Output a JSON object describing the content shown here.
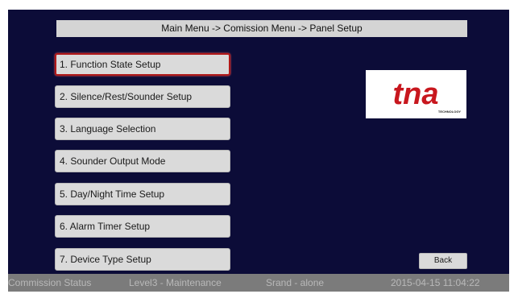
{
  "breadcrumb": "Main Menu -> Comission Menu -> Panel Setup",
  "menu": {
    "items": [
      {
        "label": "1. Function State Setup",
        "selected": true
      },
      {
        "label": "2. Silence/Rest/Sounder Setup",
        "selected": false
      },
      {
        "label": "3. Language Selection",
        "selected": false
      },
      {
        "label": "4. Sounder Output Mode",
        "selected": false
      },
      {
        "label": "5. Day/Night Time Setup",
        "selected": false
      },
      {
        "label": "6. Alarm Timer Setup",
        "selected": false
      },
      {
        "label": "7. Device Type Setup",
        "selected": false
      }
    ]
  },
  "logo": {
    "brand": "tna",
    "tagline": "TECHNOLOGY",
    "color": "#c8171e"
  },
  "back_label": "Back",
  "status": {
    "mode": "Commission Status",
    "level": "Level3 - Maintenance",
    "operation": "Srand - alone",
    "datetime": "2015-04-15 11:04:22"
  },
  "colors": {
    "screen_background": "#0c0c38",
    "button_background": "#dadada",
    "selection_border": "#b01818",
    "status_bar": "#7b7b7b"
  }
}
